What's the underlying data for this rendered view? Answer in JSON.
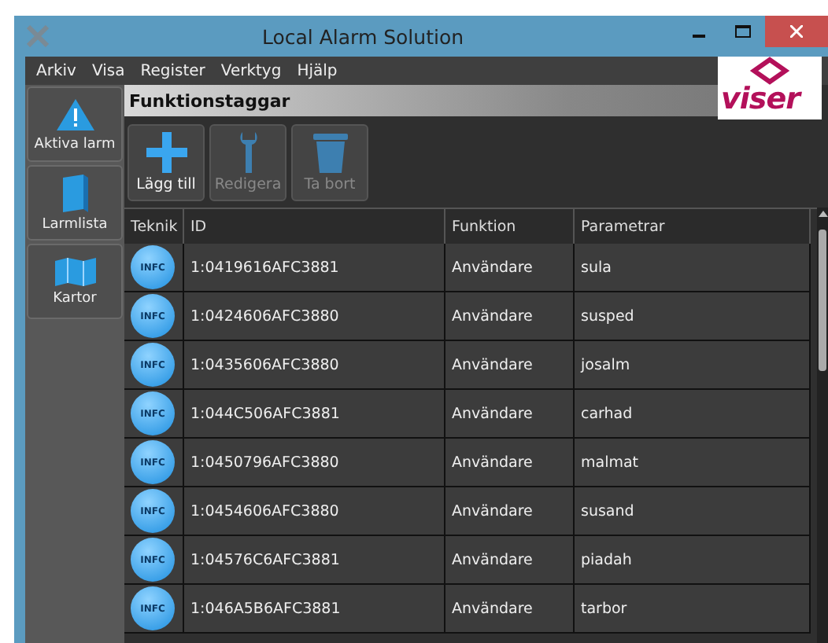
{
  "window": {
    "title": "Local Alarm Solution"
  },
  "menu": [
    "Arkiv",
    "Visa",
    "Register",
    "Verktyg",
    "Hjälp"
  ],
  "logo": {
    "text": "viser"
  },
  "sidebar": {
    "items": [
      {
        "label": "Aktiva larm",
        "kind": "alarm"
      },
      {
        "label": "Larmlista",
        "kind": "list"
      },
      {
        "label": "Kartor",
        "kind": "map"
      }
    ]
  },
  "section_title": "Funktionstaggar",
  "toolbar": [
    {
      "label": "Lägg till",
      "kind": "add",
      "disabled": false
    },
    {
      "label": "Redigera",
      "kind": "edit",
      "disabled": true
    },
    {
      "label": "Ta bort",
      "kind": "delete",
      "disabled": true
    }
  ],
  "table": {
    "columns": [
      "Teknik",
      "ID",
      "Funktion",
      "Parametrar"
    ],
    "rows": [
      {
        "teknik": "INFC",
        "id": "1:0419616AFC3881",
        "funktion": "Användare",
        "parametrar": "sula"
      },
      {
        "teknik": "INFC",
        "id": "1:0424606AFC3880",
        "funktion": "Användare",
        "parametrar": "susped"
      },
      {
        "teknik": "INFC",
        "id": "1:0435606AFC3880",
        "funktion": "Användare",
        "parametrar": "josalm"
      },
      {
        "teknik": "INFC",
        "id": "1:044C506AFC3881",
        "funktion": "Användare",
        "parametrar": "carhad"
      },
      {
        "teknik": "INFC",
        "id": "1:0450796AFC3880",
        "funktion": "Användare",
        "parametrar": "malmat"
      },
      {
        "teknik": "INFC",
        "id": "1:0454606AFC3880",
        "funktion": "Användare",
        "parametrar": "susand"
      },
      {
        "teknik": "INFC",
        "id": "1:04576C6AFC3881",
        "funktion": "Användare",
        "parametrar": "piadah"
      },
      {
        "teknik": "INFC",
        "id": "1:046A5B6AFC3881",
        "funktion": "Användare",
        "parametrar": "tarbor"
      }
    ]
  }
}
